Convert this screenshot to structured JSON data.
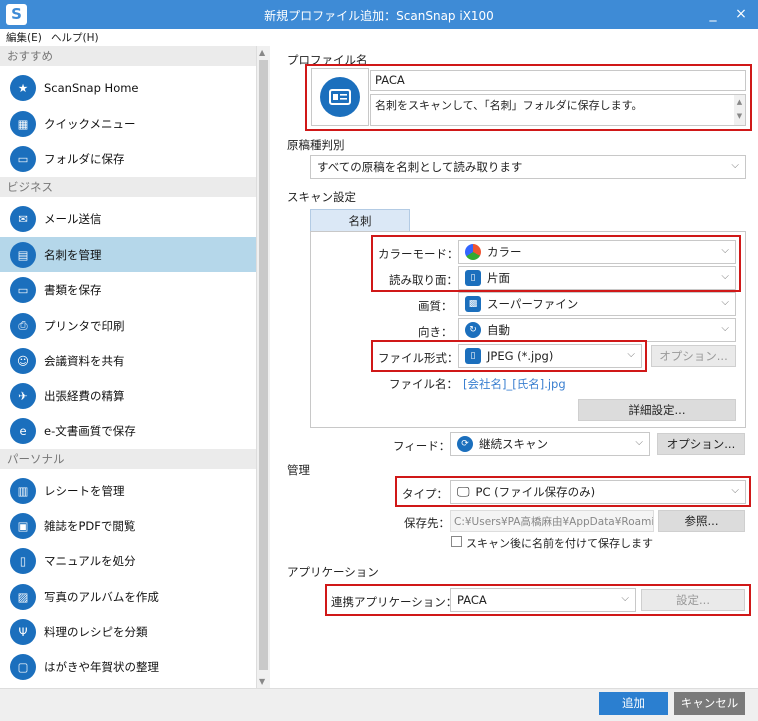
{
  "window": {
    "title": "新規プロファイル追加：ScanSnap iX100",
    "logo": "S",
    "minimize": "_",
    "close": "×"
  },
  "menu": {
    "edit": "編集(E)",
    "help": "ヘルプ(H)"
  },
  "sidebar": {
    "sections": [
      "おすすめ",
      "ビジネス",
      "パーソナル"
    ],
    "items": [
      {
        "label": "ScanSnap Home",
        "icon": "star-icon"
      },
      {
        "label": "クイックメニュー",
        "icon": "grid-icon"
      },
      {
        "label": "フォルダに保存",
        "icon": "folder-icon"
      },
      {
        "label": "メール送信",
        "icon": "mail-icon"
      },
      {
        "label": "名刺を管理",
        "icon": "card-icon"
      },
      {
        "label": "書類を保存",
        "icon": "folder-icon"
      },
      {
        "label": "プリンタで印刷",
        "icon": "printer-icon"
      },
      {
        "label": "会議資料を共有",
        "icon": "people-icon"
      },
      {
        "label": "出張経費の精算",
        "icon": "plane-icon"
      },
      {
        "label": "e-文書画質で保存",
        "icon": "edoc-icon"
      },
      {
        "label": "レシートを管理",
        "icon": "receipt-icon"
      },
      {
        "label": "雑誌をPDFで閲覧",
        "icon": "magazine-icon"
      },
      {
        "label": "マニュアルを処分",
        "icon": "book-icon"
      },
      {
        "label": "写真のアルバムを作成",
        "icon": "photo-icon"
      },
      {
        "label": "料理のレシピを分類",
        "icon": "fork-icon"
      },
      {
        "label": "はがきや年賀状の整理",
        "icon": "postcard-icon"
      }
    ]
  },
  "profile": {
    "section_label": "プロファイル名",
    "name": "PACA",
    "description": "名刺をスキャンして、「名刺」フォルダに保存します。"
  },
  "doc_type": {
    "label": "原稿種判別",
    "value": "すべての原稿を名刺として読み取ります"
  },
  "scan": {
    "label": "スキャン設定",
    "tab": "名刺",
    "color_mode": {
      "label": "カラーモード：",
      "value": "カラー"
    },
    "side": {
      "label": "読み取り面：",
      "value": "片面"
    },
    "quality": {
      "label": "画質：",
      "value": "スーパーファイン"
    },
    "orientation": {
      "label": "向き：",
      "value": "自動"
    },
    "format": {
      "label": "ファイル形式：",
      "value": "JPEG (*.jpg)",
      "option_btn": "オプション..."
    },
    "filename": {
      "label": "ファイル名：",
      "value": "[会社名]_[氏名].jpg"
    },
    "detail_btn": "詳細設定...",
    "feed": {
      "label": "フィード：",
      "value": "継続スキャン",
      "option_btn": "オプション..."
    }
  },
  "manage": {
    "label": "管理",
    "type": {
      "label": "タイプ：",
      "value": "PC (ファイル保存のみ)"
    },
    "dest": {
      "label": "保存先：",
      "value": "C:¥Users¥PA高橋麻由¥AppData¥Roamin",
      "browse_btn": "参照..."
    },
    "rename_checkbox": "スキャン後に名前を付けて保存します"
  },
  "app": {
    "label": "アプリケーション",
    "link": {
      "label": "連携アプリケーション：",
      "value": "PACA",
      "settings_btn": "設定..."
    }
  },
  "footer": {
    "add": "追加",
    "cancel": "キャンセル"
  },
  "colors": {
    "titlebar": "#3e8bd6",
    "selected": "#b5d7ea",
    "icon_blue": "#1b6fbd",
    "highlight": "#d01818"
  }
}
